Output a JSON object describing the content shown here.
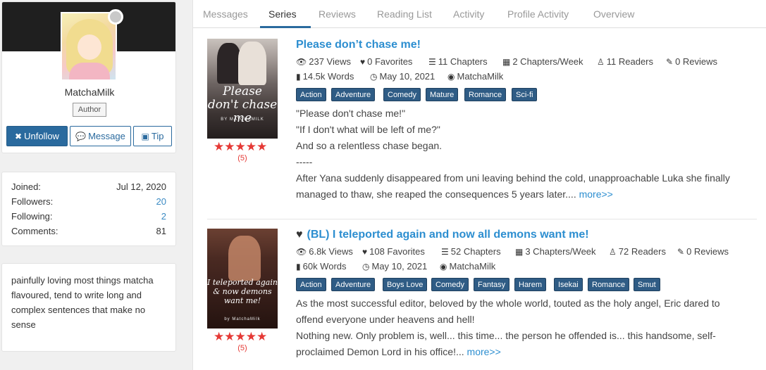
{
  "profile": {
    "username": "MatchaMilk",
    "role": "Author",
    "buttons": {
      "unfollow": "Unfollow",
      "message": "Message",
      "tip": "Tip"
    }
  },
  "stats": [
    {
      "label": "Joined:",
      "value": "Jul 12, 2020",
      "link": false
    },
    {
      "label": "Followers:",
      "value": "20",
      "link": true
    },
    {
      "label": "Following:",
      "value": "2",
      "link": true
    },
    {
      "label": "Comments:",
      "value": "81",
      "link": false
    }
  ],
  "bio": {
    "lines": [
      "painfully loving most things matcha",
      "flavoured, tend to write long and",
      "complex sentences that make no",
      "sense"
    ]
  },
  "tabs": [
    {
      "label": "Messages",
      "active": false
    },
    {
      "label": "Series",
      "active": true
    },
    {
      "label": "Reviews",
      "active": false
    },
    {
      "label": "Reading List",
      "active": false
    },
    {
      "label": "Activity",
      "active": false
    },
    {
      "label": "Profile Activity",
      "active": false
    },
    {
      "label": "Overview",
      "active": false
    }
  ],
  "series": [
    {
      "title": "Please don’t chase me!",
      "favorited_icon": false,
      "cover_title": "Please don't chase me",
      "cover_author": "BY MATCHAMILK",
      "rating_count": "(5)",
      "stars": 5,
      "meta1": {
        "views": "237 Views",
        "favorites": "0 Favorites",
        "chapters": "11 Chapters",
        "frequency": "2 Chapters/Week",
        "readers": "11 Readers",
        "reviews": "0 Reviews"
      },
      "meta2": {
        "words": "14.5k Words",
        "date": "May 10, 2021",
        "author": "MatchaMilk"
      },
      "tags": [
        "Action",
        "Adventure",
        "Comedy",
        "Mature",
        "Romance",
        "Sci-fi"
      ],
      "description": [
        "\"Please don't chase me!\"",
        "\"If I don't what will be left of me?\"",
        "And so a relentless chase began.",
        "-----",
        "After Yana suddenly disappeared from uni leaving behind the cold, unapproachable Luka she finally",
        "managed to thaw, she reaped the consequences 5 years later...."
      ],
      "more": "more>>"
    },
    {
      "title": "(BL) I teleported again and now all demons want me!",
      "favorited_icon": true,
      "cover_title": "I teleported again & now demons want me!",
      "cover_author": "by MatchaMilk",
      "rating_count": "(5)",
      "stars": 5,
      "meta1": {
        "views": "6.8k Views",
        "favorites": "108 Favorites",
        "chapters": "52 Chapters",
        "frequency": "3 Chapters/Week",
        "readers": "72 Readers",
        "reviews": "0 Reviews"
      },
      "meta2": {
        "words": "60k Words",
        "date": "May 10, 2021",
        "author": "MatchaMilk"
      },
      "tags": [
        "Action",
        "Adventure",
        "Boys Love",
        "Comedy",
        "Fantasy",
        "Harem",
        "Isekai",
        "Romance",
        "Smut"
      ],
      "description": [
        "As the most successful editor, beloved by the whole world, touted as the holy angel, Eric dared to",
        "offend everyone under heavens and hell!",
        "Nothing new. Only problem is, well... this time... the person he offended is... this handsome, self-",
        "proclaimed Demon Lord in his office!..."
      ],
      "more": "more>>"
    }
  ],
  "colors": {
    "accent": "#2a6a9e",
    "link": "#2c8ed0",
    "tag": "#2f5c85",
    "star": "#e53935"
  }
}
